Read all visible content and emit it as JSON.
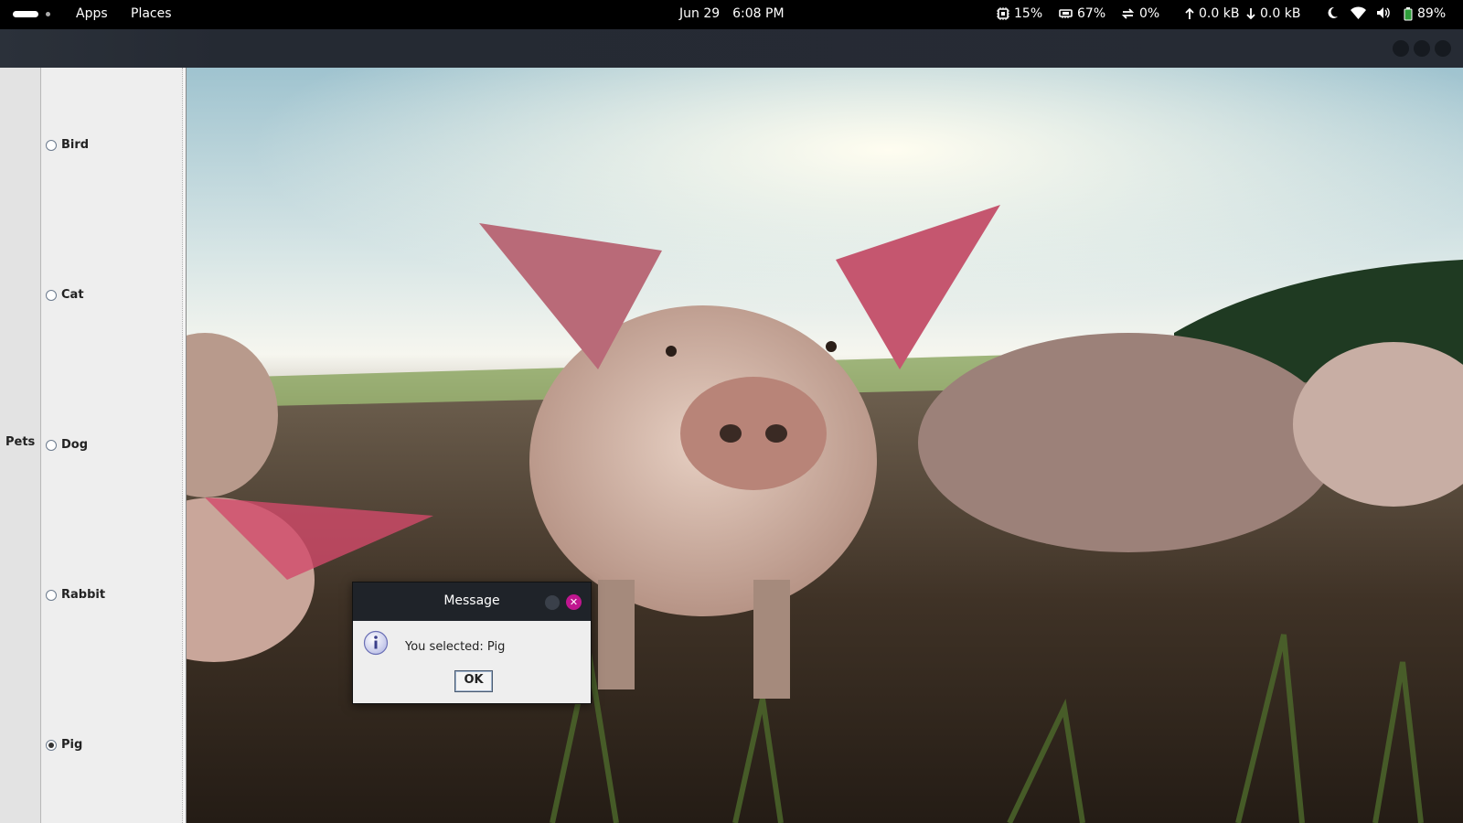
{
  "topbar": {
    "apps_label": "Apps",
    "places_label": "Places",
    "date": "Jun 29",
    "time": "6:08 PM",
    "cpu": "15%",
    "memory": "67%",
    "swap": "0%",
    "upload": "0.0 kB",
    "download": "0.0 kB",
    "battery": "89%"
  },
  "sidebar": {
    "tab_label": "Pets",
    "options": [
      {
        "label": "Bird",
        "selected": false
      },
      {
        "label": "Cat",
        "selected": false
      },
      {
        "label": "Dog",
        "selected": false
      },
      {
        "label": "Rabbit",
        "selected": false
      },
      {
        "label": "Pig",
        "selected": true
      }
    ]
  },
  "dialog": {
    "title": "Message",
    "message": "You selected: Pig",
    "ok_label": "OK",
    "icon": "info-icon"
  },
  "photo": {
    "subject": "pig-photo"
  },
  "colors": {
    "topbar_bg": "#000000",
    "header_bg": "#262b34",
    "close_button": "#c0168f",
    "panel_bg": "#eeeeee"
  }
}
